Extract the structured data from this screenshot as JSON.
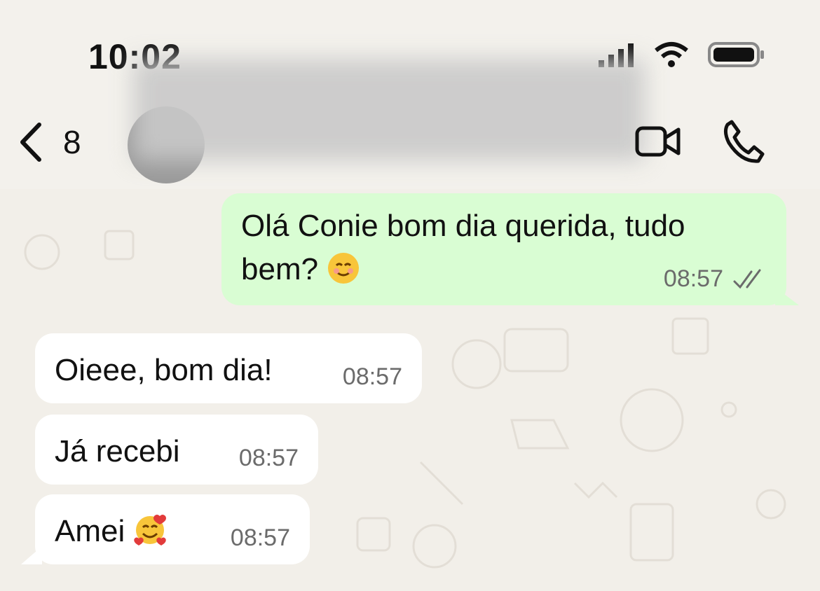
{
  "status_bar": {
    "time": "10:02"
  },
  "header": {
    "unread_count": "8"
  },
  "messages": [
    {
      "direction": "outgoing",
      "text": "Olá Conie bom dia querida, tudo bem?",
      "emoji": "smiling-face-icon",
      "time": "08:57",
      "status": "read"
    },
    {
      "direction": "incoming",
      "text": "Oieee, bom dia!",
      "time": "08:57"
    },
    {
      "direction": "incoming",
      "text": "Já recebi",
      "time": "08:57"
    },
    {
      "direction": "incoming",
      "text": "Amei",
      "emoji": "smiling-face-with-hearts-icon",
      "time": "08:57"
    }
  ],
  "colors": {
    "outgoing_bubble": "#d9fdd3",
    "incoming_bubble": "#ffffff",
    "wallpaper": "#f2efe9",
    "read_ticks": "#6b6b6b"
  }
}
